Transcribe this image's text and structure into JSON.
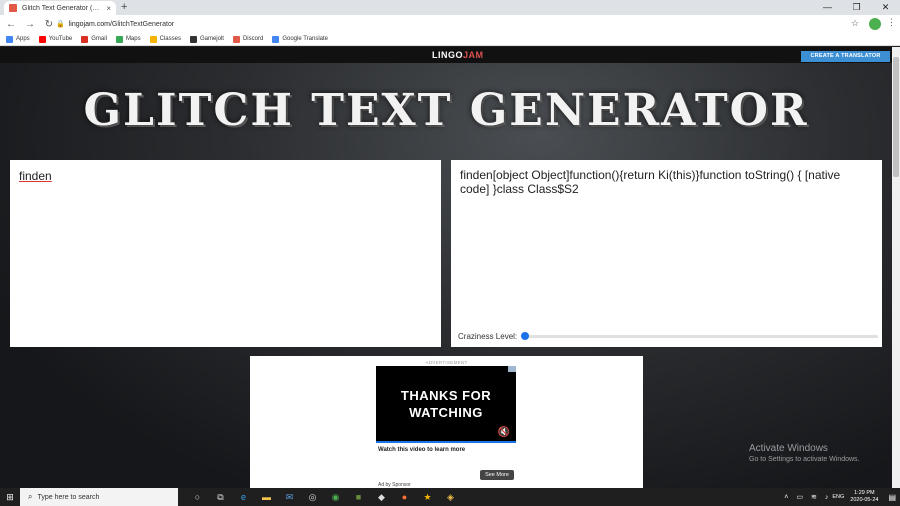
{
  "browser": {
    "tab_title": "Glitch Text Generator (copy and...",
    "tab_close": "×",
    "new_tab": "+",
    "url_host": "lingojam.com",
    "url_path": "/GlitchTextGenerator",
    "window_controls": [
      "—",
      "❐",
      "✕"
    ],
    "bookmarks": [
      {
        "label": "Apps",
        "color": "#4285f4"
      },
      {
        "label": "YouTube",
        "color": "#ff0000"
      },
      {
        "label": "Gmail",
        "color": "#d93025"
      },
      {
        "label": "Maps",
        "color": "#34a853"
      },
      {
        "label": "Classes",
        "color": "#f4b400"
      },
      {
        "label": "Gamejolt",
        "color": "#333333"
      },
      {
        "label": "Discord",
        "color": "#e05a47"
      },
      {
        "label": "Google Translate",
        "color": "#4285f4"
      }
    ]
  },
  "site": {
    "logo_main": "LINGO",
    "logo_accent": "JAM",
    "create_button": "CREATE A TRANSLATOR",
    "hero_title": "GLITCH TEXT GENERATOR"
  },
  "translator": {
    "input_text": "finden",
    "output_text": "finden[object Object]function(){return Ki(this)}function toString() { [native code] }class Class$S2",
    "craziness_label": "Craziness Level:",
    "craziness_value": 0
  },
  "ad": {
    "label": "ADVERTISEMENT",
    "video_text": "THANKS FOR WATCHING",
    "cta": "Watch this video to learn more",
    "sponsor": "Ad by Sponsor",
    "see_more": "See More"
  },
  "watermark": {
    "line1": "Activate Windows",
    "line2": "Go to Settings to activate Windows."
  },
  "taskbar": {
    "search_placeholder": "Type here to search",
    "language": "ENG",
    "time": "1:29 PM",
    "date": "2020-05-24"
  },
  "colors": {
    "accent_blue": "#3d8fd4",
    "slider_blue": "#1a73e8"
  }
}
